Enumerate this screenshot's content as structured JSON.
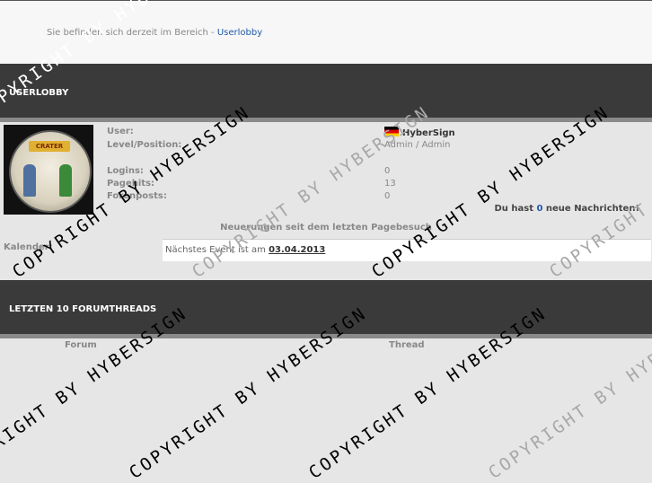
{
  "breadcrumb": {
    "prefix": "Sie befinden sich derzeit im Bereich - ",
    "current": "Userlobby"
  },
  "userlobby": {
    "title": "USERLOBBY",
    "avatar_text": "CRATER",
    "labels": {
      "user": "User:",
      "level": "Level/Position:",
      "logins": "Logins:",
      "pagehits": "Pagehits:",
      "forenposts": "Forenposts:"
    },
    "values": {
      "user": "HyberSign",
      "level": "Admin / Admin",
      "logins": "0",
      "pagehits": "13",
      "forenposts": "0"
    },
    "messages": {
      "prefix": "Du hast ",
      "count": "0",
      "suffix": " neue Nachrichten!"
    },
    "updates_title": "Neuerungen seit dem letzten Pagebesuch",
    "kalender_label": "Kalender:",
    "event": {
      "prefix": "Nächstes Event ist am ",
      "date": "03.04.2013"
    }
  },
  "forumthreads": {
    "title": "LETZTEN 10 FORUMTHREADS",
    "col_forum": "Forum",
    "col_thread": "Thread"
  },
  "watermark": "COPYRIGHT BY HYBERSIGN",
  "colors": {
    "bar": "#3a3a3a",
    "link": "#1f5aa8",
    "page_bg": "#e6e6e6"
  }
}
